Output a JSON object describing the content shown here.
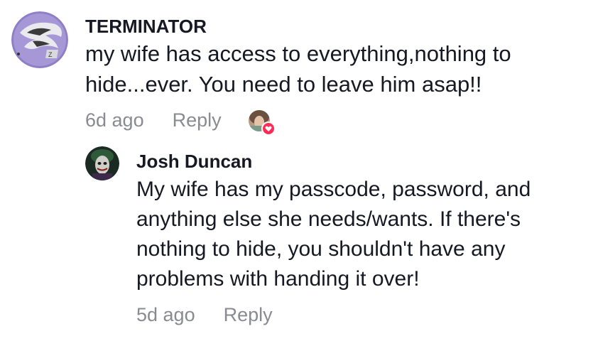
{
  "comments": [
    {
      "username": "TERMINATOR",
      "text": "my wife has access to everything,nothing to hide...ever. You need to leave him asap!!",
      "time": "6d ago",
      "reply_label": "Reply",
      "avatar_icon": "dragon-logo-avatar",
      "liked_by_creator": true
    }
  ],
  "replies": [
    {
      "username": "Josh Duncan",
      "text": "My wife has my passcode, password, and anything else she needs/wants. If there's nothing to hide, you shouldn't have any problems with handing it over!",
      "time": "5d ago",
      "reply_label": "Reply",
      "avatar_icon": "joker-avatar"
    }
  ],
  "colors": {
    "text": "#161823",
    "meta": "#8a8b91",
    "heart": "#fe2c55",
    "avatar1_bg": "#8e7cc3"
  }
}
